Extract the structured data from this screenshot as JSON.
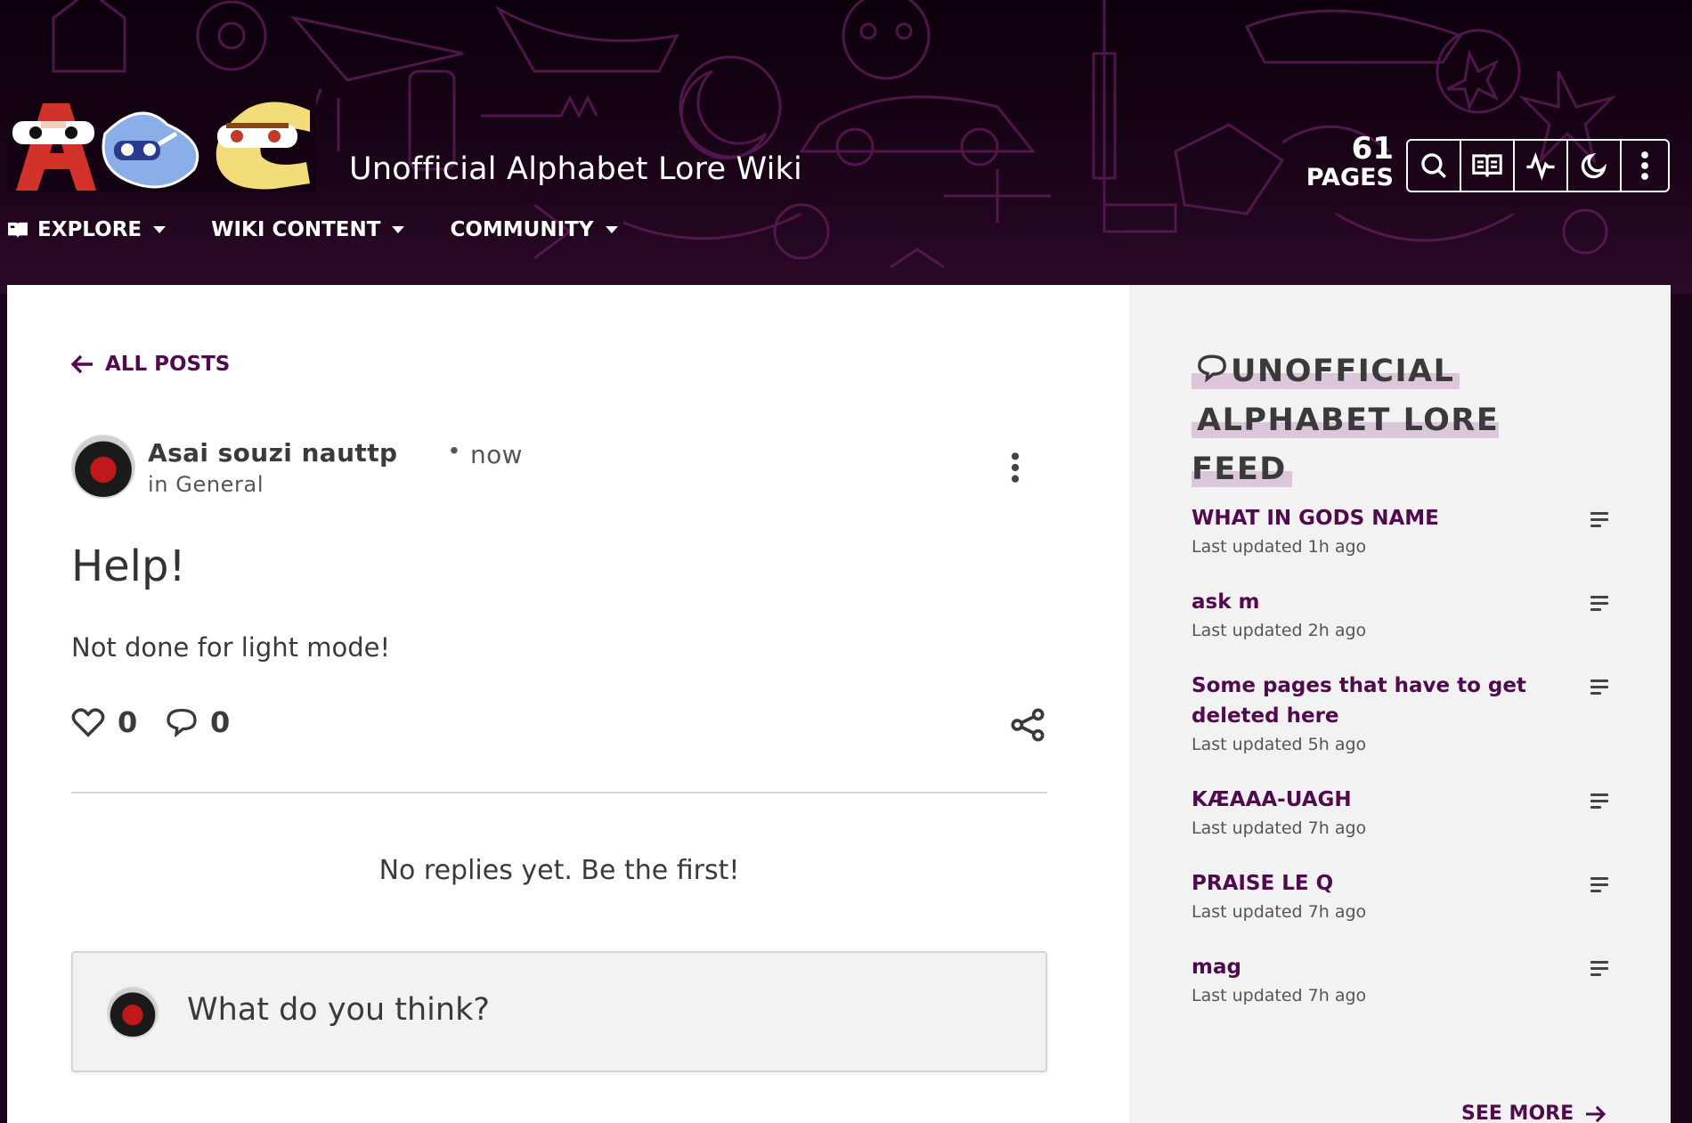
{
  "header": {
    "wiki_title": "Unofficial Alphabet Lore Wiki",
    "pages_count": "61",
    "pages_label": "PAGES",
    "toolbar_icons": [
      "search-icon",
      "book-icon",
      "activity-icon",
      "moon-icon",
      "more-vertical-icon"
    ],
    "nav": [
      {
        "label": "EXPLORE",
        "icon": "book-icon"
      },
      {
        "label": "WIKI CONTENT"
      },
      {
        "label": "COMMUNITY"
      }
    ]
  },
  "post": {
    "back_label": "ALL POSTS",
    "author": "Asai souzi nauttp",
    "separator": "•",
    "time": "now",
    "category": "in General",
    "title": "Help!",
    "body": "Not done for light mode!",
    "likes": "0",
    "comments": "0",
    "no_replies": "No replies yet. Be the first!",
    "reply_placeholder": "What do you think?"
  },
  "feed": {
    "title_line1": "UNOFFICIAL",
    "title_line2": "ALPHABET LORE FEED",
    "items": [
      {
        "title": "WHAT IN GODS NAME",
        "meta": "Last updated 1h ago"
      },
      {
        "title": "ask m",
        "meta": "Last updated 2h ago"
      },
      {
        "title": "Some pages that have to get deleted here",
        "meta": "Last updated 5h ago"
      },
      {
        "title": "KÆAAA-UAGH",
        "meta": "Last updated 7h ago"
      },
      {
        "title": "PRAISE LE Q",
        "meta": "Last updated 7h ago"
      },
      {
        "title": "mag",
        "meta": "Last updated 7h ago"
      }
    ],
    "see_more": "SEE MORE"
  },
  "colors": {
    "accent": "#520a4e",
    "header_bg": "#1c0419",
    "rail_bg": "#f2f2f2",
    "highlight": "#dcc6da"
  }
}
